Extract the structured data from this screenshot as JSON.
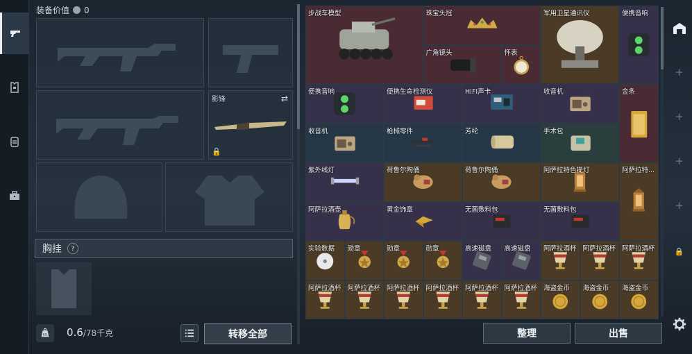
{
  "equipment": {
    "value_label": "装备价值",
    "value_amount": "0",
    "slot_melee_label": "影锋",
    "chest_label": "胸挂",
    "chest_help": "?",
    "weight_current": "0.6",
    "weight_max": "/78千克",
    "kg_badge": "KG",
    "transfer_all": "转移全部"
  },
  "stash": {
    "items": [
      {
        "name": "步战车模型",
        "rarity": "red",
        "icon": "vehicle-icon"
      },
      {
        "name": "珠宝头冠",
        "rarity": "red",
        "icon": "crown-icon"
      },
      {
        "name": "军用卫星通讯仪",
        "rarity": "gold",
        "icon": "satellite-icon"
      },
      {
        "name": "便携音响",
        "rarity": "purple",
        "icon": "speaker-icon"
      },
      {
        "name": "广角镜头",
        "rarity": "red",
        "icon": "lens-icon"
      },
      {
        "name": "怀表",
        "rarity": "red",
        "icon": "pocket-watch-icon"
      },
      {
        "name": "便携音响",
        "rarity": "purple",
        "icon": "speaker-icon"
      },
      {
        "name": "便携生命检测仪",
        "rarity": "purple",
        "icon": "detector-icon"
      },
      {
        "name": "HIFI声卡",
        "rarity": "purple",
        "icon": "soundcard-icon"
      },
      {
        "name": "收音机",
        "rarity": "purple",
        "icon": "radio-icon"
      },
      {
        "name": "金条",
        "rarity": "red",
        "icon": "gold-bar-icon"
      },
      {
        "name": "收音机",
        "rarity": "blue",
        "icon": "radio-icon"
      },
      {
        "name": "枪械零件",
        "rarity": "blue",
        "icon": "gun-parts-icon"
      },
      {
        "name": "芳纶",
        "rarity": "blue",
        "icon": "aramid-roll-icon"
      },
      {
        "name": "手术包",
        "rarity": "green",
        "icon": "surgery-kit-icon"
      },
      {
        "name": "紫外线灯",
        "rarity": "purple",
        "icon": "uv-lamp-icon"
      },
      {
        "name": "荷鲁尔陶俑",
        "rarity": "gold",
        "icon": "figurine-icon"
      },
      {
        "name": "荷鲁尔陶俑",
        "rarity": "gold",
        "icon": "figurine-icon"
      },
      {
        "name": "阿萨拉特色提灯",
        "rarity": "gold",
        "icon": "lantern-icon"
      },
      {
        "name": "阿萨拉特...",
        "rarity": "gold",
        "icon": "lantern-icon"
      },
      {
        "name": "阿萨拉酒壶",
        "rarity": "purple",
        "icon": "wine-jug-icon"
      },
      {
        "name": "黄金饰章",
        "rarity": "purple",
        "icon": "gold-emblem-icon"
      },
      {
        "name": "无菌敷料包",
        "rarity": "purple",
        "icon": "dressing-pack-icon"
      },
      {
        "name": "无菌敷料包",
        "rarity": "purple",
        "icon": "dressing-pack-icon"
      },
      {
        "name": "实验数据",
        "rarity": "gold",
        "icon": "data-disc-icon"
      },
      {
        "name": "勋章",
        "rarity": "gold",
        "icon": "medal-icon"
      },
      {
        "name": "勋章",
        "rarity": "gold",
        "icon": "medal-icon"
      },
      {
        "name": "勋章",
        "rarity": "gold",
        "icon": "medal-icon"
      },
      {
        "name": "高速磁盘",
        "rarity": "purple",
        "icon": "disk-icon"
      },
      {
        "name": "高速磁盘",
        "rarity": "purple",
        "icon": "disk-icon"
      },
      {
        "name": "阿萨拉酒杯",
        "rarity": "gold",
        "icon": "goblet-icon"
      },
      {
        "name": "阿萨拉酒杯",
        "rarity": "gold",
        "icon": "goblet-icon"
      },
      {
        "name": "阿萨拉酒杯",
        "rarity": "gold",
        "icon": "goblet-icon"
      },
      {
        "name": "阿萨拉酒杯",
        "rarity": "gold",
        "icon": "goblet-icon"
      },
      {
        "name": "阿萨拉酒杯",
        "rarity": "gold",
        "icon": "goblet-icon"
      },
      {
        "name": "阿萨拉酒杯",
        "rarity": "gold",
        "icon": "goblet-icon"
      },
      {
        "name": "阿萨拉酒杯",
        "rarity": "gold",
        "icon": "goblet-icon"
      },
      {
        "name": "阿萨拉酒杯",
        "rarity": "gold",
        "icon": "goblet-icon"
      },
      {
        "name": "阿萨拉酒杯",
        "rarity": "gold",
        "icon": "goblet-icon"
      },
      {
        "name": "海盗金币",
        "rarity": "gold",
        "icon": "pirate-coin-icon"
      },
      {
        "name": "海盗金币",
        "rarity": "gold",
        "icon": "pirate-coin-icon"
      },
      {
        "name": "海盗金币",
        "rarity": "gold",
        "icon": "pirate-coin-icon"
      }
    ],
    "sort_label": "整理",
    "sell_label": "出售"
  },
  "colors": {
    "red": "#4a2b34",
    "gold": "#4a3a26",
    "purple": "#36304a",
    "blue": "#263848",
    "green": "#2a3e3e"
  }
}
